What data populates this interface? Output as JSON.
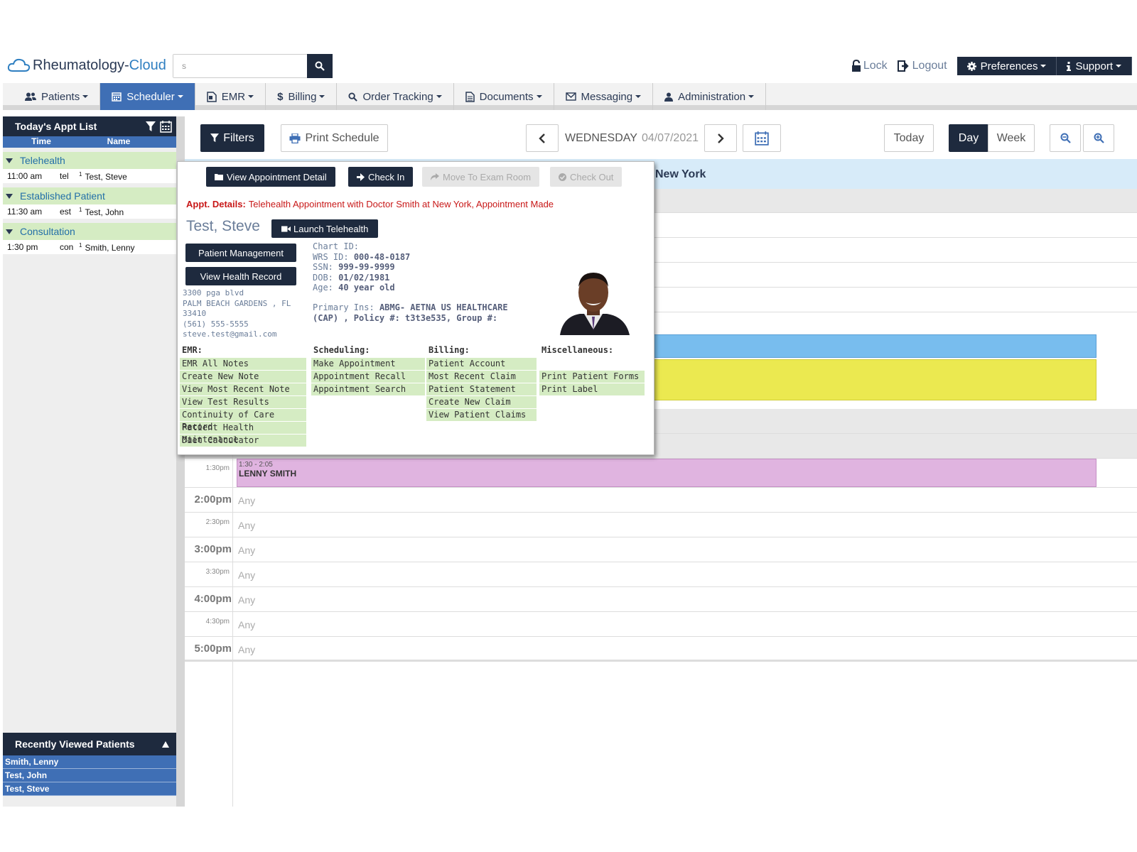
{
  "app": {
    "logo_main": "Rheumatology-",
    "logo_cloud": "Cloud"
  },
  "search": {
    "value": "s"
  },
  "top_right": {
    "lock": "Lock",
    "logout": "Logout",
    "preferences": "Preferences",
    "support": "Support"
  },
  "nav": {
    "items": [
      {
        "label": "Patients",
        "icon": "users-icon"
      },
      {
        "label": "Scheduler",
        "icon": "calendar-icon"
      },
      {
        "label": "EMR",
        "icon": "file-icon"
      },
      {
        "label": "Billing",
        "icon": "dollar-icon"
      },
      {
        "label": "Order Tracking",
        "icon": "search-icon"
      },
      {
        "label": "Documents",
        "icon": "document-icon"
      },
      {
        "label": "Messaging",
        "icon": "envelope-icon"
      },
      {
        "label": "Administration",
        "icon": "user-icon"
      }
    ]
  },
  "sidebar": {
    "title": "Today's Appt List",
    "col_time": "Time",
    "col_name": "Name",
    "groups": [
      {
        "title": "Telehealth",
        "time": "11:00 am",
        "code": "tel",
        "num": "1",
        "name": "Test, Steve"
      },
      {
        "title": "Established Patient",
        "time": "11:30 am",
        "code": "est",
        "num": "1",
        "name": "Test, John"
      },
      {
        "title": "Consultation",
        "time": "1:30 pm",
        "code": "con",
        "num": "1",
        "name": "Smith, Lenny"
      }
    ],
    "recent_title": "Recently Viewed Patients",
    "recent": [
      "Smith, Lenny",
      "Test, John",
      "Test, Steve"
    ]
  },
  "toolbar": {
    "filters": "Filters",
    "print": "Print Schedule",
    "weekday": "WEDNESDAY",
    "date": "04/07/2021",
    "today": "Today",
    "day": "Day",
    "week": "Week"
  },
  "location": "New York",
  "grid": {
    "rows": [
      {
        "label": "1:30pm",
        "big": false
      },
      {
        "label": "2:00pm",
        "big": true
      },
      {
        "label": "2:30pm",
        "big": false
      },
      {
        "label": "3:00pm",
        "big": true
      },
      {
        "label": "3:30pm",
        "big": false
      },
      {
        "label": "4:00pm",
        "big": true
      },
      {
        "label": "4:30pm",
        "big": false
      },
      {
        "label": "5:00pm",
        "big": true
      }
    ],
    "any": "Any",
    "lenny_time": "1:30 - 2:05",
    "lenny_name": "LENNY SMITH"
  },
  "popover": {
    "view_detail": "View Appointment Detail",
    "check_in": "Check In",
    "move_exam": "Move To Exam Room",
    "check_out": "Check Out",
    "details_label": "Appt. Details:",
    "details_text": "Telehealth Appointment with Doctor Smith at New York, Appointment Made",
    "patient_name": "Test, Steve",
    "launch_telehealth": "Launch Telehealth",
    "patient_mgmt": "Patient Management",
    "view_record": "View Health Record",
    "address": [
      "3300 pga blvd",
      "PALM BEACH GARDENS , FL",
      "33410",
      "(561) 555-5555",
      "steve.test@gmail.com"
    ],
    "chart_id_label": "Chart ID:",
    "wrs_label": "WRS ID:",
    "wrs_value": "000-48-0187",
    "ssn_label": "SSN:",
    "ssn_value": "999-99-9999",
    "dob_label": "DOB:",
    "dob_value": "01/02/1981",
    "age_label": "Age:",
    "age_value": "40 year old",
    "ins_label": "Primary Ins:",
    "ins_value_1": "ABMG- AETNA US HEALTHCARE",
    "ins_value_2": "(CAP) , Policy #: t3t3e535, Group #:",
    "emr": {
      "title": "EMR:",
      "links": [
        "EMR All Notes",
        "Create New Note",
        "View Most Recent Note",
        "View Test Results",
        "Continuity of Care Record",
        "Patient Health Maintenance",
        "Diet Calculator"
      ]
    },
    "scheduling": {
      "title": "Scheduling:",
      "links": [
        "Make Appointment",
        "Appointment Recall",
        "Appointment Search"
      ]
    },
    "billing": {
      "title": "Billing:",
      "links": [
        "Patient Account",
        "Most Recent Claim",
        "Patient Statement",
        "Create New Claim",
        "View Patient Claims"
      ]
    },
    "misc": {
      "title": "Miscellaneous:",
      "links": [
        "",
        "Print Patient Forms",
        "Print Label"
      ]
    }
  },
  "colors": {
    "navy": "#1e2a3e",
    "blue": "#3f6fb5",
    "green": "#d5ecc3",
    "appt_blue": "#78bdee",
    "appt_yellow": "#ebe950",
    "appt_purple": "#e0b4e0",
    "detail_red": "#c81818"
  }
}
